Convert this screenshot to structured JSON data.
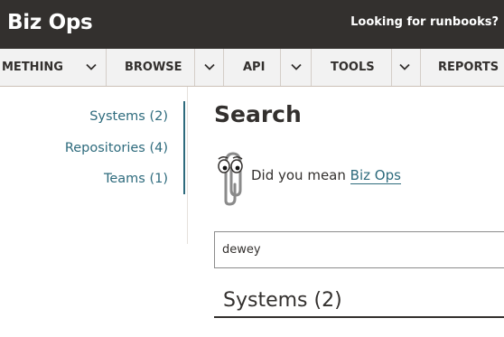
{
  "header": {
    "brand": "Biz Ops",
    "runbooks_link": "Looking for runbooks?"
  },
  "nav": {
    "items": [
      {
        "label": "METHING"
      },
      {
        "label": "BROWSE"
      },
      {
        "label": "API"
      },
      {
        "label": "TOOLS"
      },
      {
        "label": "REPORTS"
      }
    ],
    "dropdown_icon": "chevron-down-icon"
  },
  "sidebar": {
    "items": [
      {
        "label": "Systems (2)"
      },
      {
        "label": "Repositories (4)"
      },
      {
        "label": "Teams (1)"
      }
    ]
  },
  "main": {
    "title": "Search",
    "suggestion": {
      "prefix": "Did you mean",
      "link": "Biz Ops",
      "icon": "paperclip-assistant-icon"
    },
    "search": {
      "value": "dewey"
    },
    "section_title": "Systems (2)"
  },
  "colors": {
    "header_bg": "#33302e",
    "nav_bg": "#f2f2f2",
    "link": "#2e6b7d",
    "text": "#33302e"
  }
}
